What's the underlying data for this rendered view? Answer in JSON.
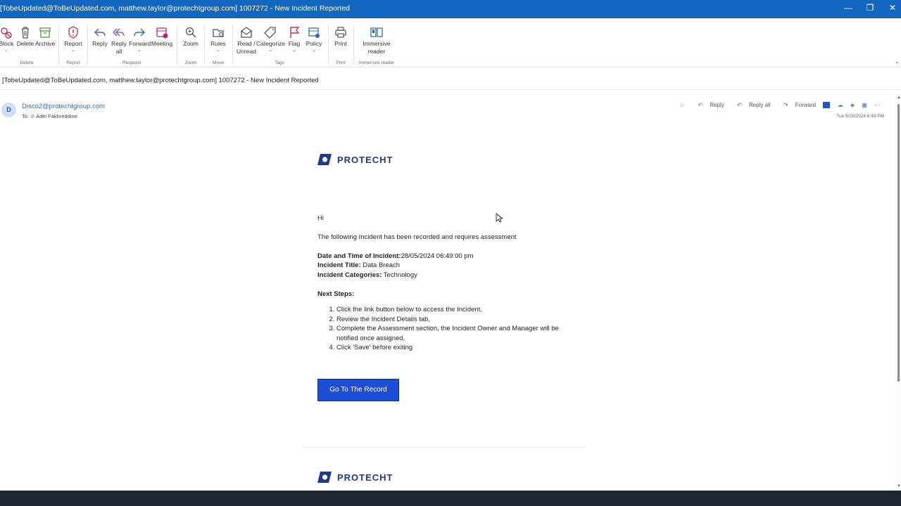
{
  "window": {
    "title": "[TobeUpdated@ToBeUpdated.com, matthew.taylor@protechtgroup.com] 1007272 - New Incident Reported",
    "controls": [
      "—",
      "❐",
      "✕"
    ]
  },
  "ribbon": {
    "buttons": {
      "block": "Block",
      "delete": "Delete",
      "archive": "Archive",
      "report": "Report",
      "reply": "Reply",
      "reply_all_1": "Reply",
      "reply_all_2": "all",
      "forward": "Forward",
      "meeting": "Meeting",
      "zoom": "Zoom",
      "rules": "Rules",
      "read_unread_1": "Read /",
      "read_unread_2": "Unread",
      "categorize": "Categorize",
      "flag": "Flag",
      "policy": "Policy",
      "print": "Print",
      "immersive_1": "Immersive",
      "immersive_2": "reader"
    },
    "groups": {
      "delete": "Delete",
      "report": "Report",
      "respond": "Respond",
      "zoom": "Zoom",
      "move": "Move",
      "tags": "Tags",
      "print": "Print",
      "immersive": "Immersive reader"
    }
  },
  "message": {
    "subject": "[TobeUpdated@ToBeUpdated.com, matthew.taylor@protechtgroup.com] 1007272 - New Incident Reported",
    "avatar_initial": "D",
    "sender": "Disco2@protechtgroup.com",
    "to_label": "To:",
    "recipient": "Adel Fakhreddine",
    "actions": {
      "reply": "Reply",
      "reply_all": "Reply all",
      "forward": "Forward"
    },
    "date": "Tue 5/28/2024 6:49 PM"
  },
  "email": {
    "brand": "PROTECHT",
    "greeting": "Hi",
    "intro": "The following Incident has been recorded and requires assessment",
    "date_label": "Date and Time of Incident:",
    "date_value": "28/05/2024 06:49:00 pm",
    "title_label": "Incident Title:",
    "title_value": " Data Breach",
    "categories_label": "Incident Categories:",
    "categories_value": " Technology",
    "next_steps_label": "Next Steps:",
    "steps": [
      "Click the link button below to access the Incident,",
      "Review the Incident Details tab,",
      "Complete the Assessment section, the Incident Owner and Manager will be notified once assigned,",
      "Click 'Save' before exiting"
    ],
    "cta": "Go To The Record"
  },
  "colors": {
    "titlebar": "#1366c0",
    "accent_link": "#2b6cb0",
    "cta": "#1d4ed8",
    "brand": "#1e3a8a"
  }
}
